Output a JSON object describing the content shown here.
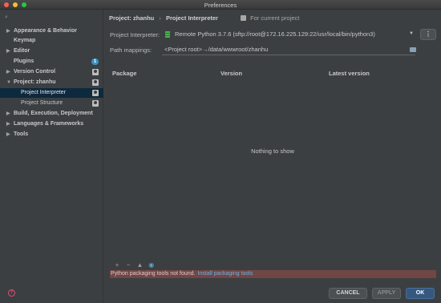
{
  "window": {
    "title": "Preferences"
  },
  "sidebar": {
    "search_icon": "search-icon",
    "items": [
      {
        "label": "Appearance & Behavior",
        "arrow": "▶"
      },
      {
        "label": "Keymap",
        "arrow": ""
      },
      {
        "label": "Editor",
        "arrow": "▶"
      },
      {
        "label": "Plugins",
        "arrow": "",
        "badge": "1"
      },
      {
        "label": "Version Control",
        "arrow": "▶"
      },
      {
        "label": "Project: zhanhu",
        "arrow": "▼"
      },
      {
        "label": "Project Interpreter",
        "arrow": ""
      },
      {
        "label": "Project Structure",
        "arrow": ""
      },
      {
        "label": "Build, Execution, Deployment",
        "arrow": "▶"
      },
      {
        "label": "Languages & Frameworks",
        "arrow": "▶"
      },
      {
        "label": "Tools",
        "arrow": "▶"
      }
    ],
    "help_icon": "?"
  },
  "main": {
    "breadcrumb": {
      "parent": "Project: zhanhu",
      "separator": "›",
      "current": "Project Interpreter"
    },
    "for_current": "For current project",
    "interpreter_label": "Project Interpreter:",
    "interpreter_value": "Remote Python 3.7.6 (sftp://root@172.16.225.129:22/usr/local/bin/python3)",
    "interpreter_chevron": "▼",
    "more_label": "⋮",
    "path_label": "Path mappings:",
    "path_value": "<Project root>→/data/wwwroot/zhanhu",
    "table": {
      "columns": [
        "Package",
        "Version",
        "Latest version"
      ],
      "empty_text": "Nothing to show"
    },
    "toolbar": {
      "add": "+",
      "remove": "−",
      "upgrade": "▲",
      "show": "◉"
    },
    "warning": {
      "text": "Python packaging tools not found.",
      "link": "Install packaging tools"
    }
  },
  "buttons": {
    "cancel": "CANCEL",
    "apply": "APPLY",
    "ok": "OK"
  },
  "colors": {
    "accent": "#365880",
    "selection": "#0d293e",
    "warning_bg": "#704745",
    "link": "#6fb0e3"
  }
}
